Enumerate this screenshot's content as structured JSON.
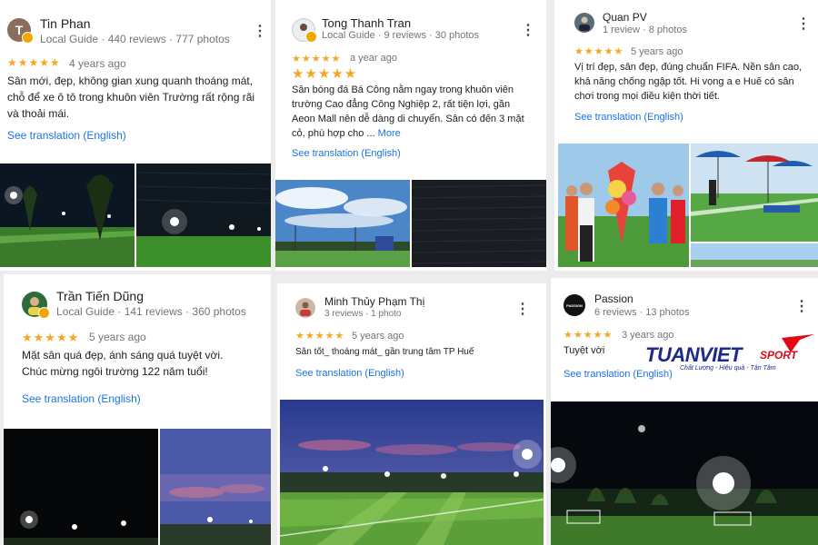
{
  "reviews": [
    {
      "avatar_letter": "T",
      "avatar_color": "#8a6d5a",
      "name": "Tin Phan",
      "meta": "Local Guide · 440 reviews · 777 photos",
      "stars": "★★★★★",
      "when": "4 years ago",
      "text": "Sân mới, đẹp, không gian xung quanh thoáng mát, chỗ để xe ô tô trong khuôn viên Trường rất rộng rãi và thoải mái.",
      "translate": "See translation (English)"
    },
    {
      "avatar_letter": "",
      "avatar_color": "#e8eef2",
      "name": "Tong Thanh Tran",
      "meta": "Local Guide · 9 reviews · 30 photos",
      "stars": "★★★★★",
      "when": "a year ago",
      "stars_large": "★★★★★",
      "text": "Sân bóng đá Bá Công nằm ngay trong khuôn viên trường Cao đẳng Công Nghiệp 2, rất tiện lợi, gần Aeon Mall nên dễ dàng di chuyển. Sân có đến 3 mặt cỏ, phù hợp cho ...",
      "more": "More",
      "translate": "See translation (English)"
    },
    {
      "avatar_letter": "",
      "avatar_color": "#5a6b7a",
      "name": "Quan PV",
      "meta": "1 review · 8 photos",
      "stars": "★★★★★",
      "when": "5 years ago",
      "text": "Vị trí đẹp, sân đẹp, đúng chuẩn FIFA. Nền sân cao, khả năng chống ngập tốt. Hi vọng a e Huế có sân chơi trong mọi điều kiện thời tiết.",
      "translate": "See translation (English)"
    },
    {
      "avatar_letter": "",
      "avatar_color": "#2e6b3a",
      "name": "Trần Tiến Dũng",
      "meta": "Local Guide · 141 reviews · 360 photos",
      "stars": "★★★★★",
      "when": "5 years ago",
      "text": "Mặt sân quá đẹp, ánh sáng quá tuyệt vời. Chúc mừng ngôi trường 122 năm tuổi!",
      "translate": "See translation (English)"
    },
    {
      "avatar_letter": "",
      "avatar_color": "#c9b8a8",
      "name": "Minh Thủy Phạm Thị",
      "meta": "3 reviews · 1 photo",
      "stars": "★★★★★",
      "when": "5 years ago",
      "text": "Sân tốt_ thoáng mát_ gần trung tâm TP Huế",
      "translate": "See translation (English)"
    },
    {
      "avatar_letter": "PASSION",
      "avatar_color": "#111111",
      "name": "Passion",
      "meta": "6 reviews · 13 photos",
      "stars": "★★★★★",
      "when": "3 years ago",
      "text": "Tuyệt vời",
      "translate": "See translation (English)"
    }
  ],
  "watermark": {
    "brand_main": "TUANVIET",
    "brand_sub": "SPORT",
    "tagline": "Chất Lượng - Hiệu quả - Tận Tâm",
    "brand_color": "#1d2a8c",
    "accent_color": "#e30613"
  },
  "menu_icon": "⋮",
  "colors": {
    "star": "#f5a623",
    "link": "#1a73e8",
    "text": "#202124",
    "muted": "#70757a"
  }
}
